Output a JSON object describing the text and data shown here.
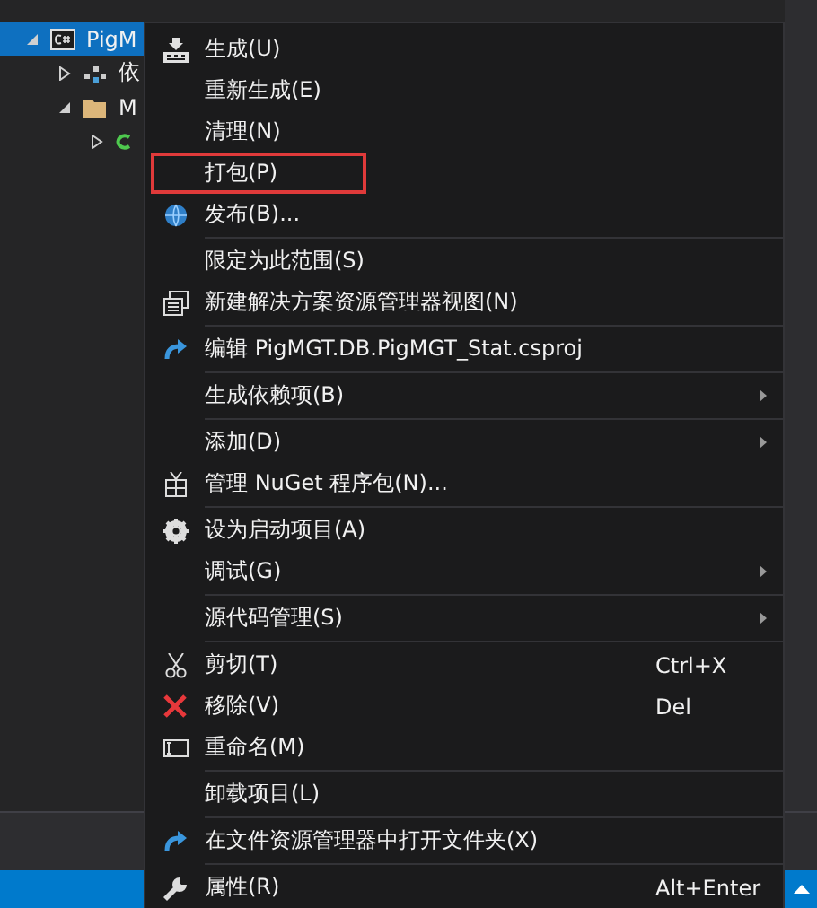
{
  "tree": [
    {
      "label": "PigM",
      "kind": "csharp",
      "expanded": true,
      "selected": true,
      "children": [
        {
          "label": "依",
          "kind": "deps",
          "expanded": false,
          "selected": false
        },
        {
          "label": "M",
          "kind": "folder",
          "expanded": true,
          "selected": false,
          "children": [
            {
              "kind": "class",
              "expanded": false,
              "selected": false
            }
          ]
        }
      ]
    }
  ],
  "menu": {
    "groups": [
      [
        {
          "label": "生成(U)",
          "kind": "build",
          "annotated": false
        },
        {
          "label": "重新生成(E)",
          "annotated": false
        },
        {
          "label": "清理(N)",
          "annotated": false
        },
        {
          "label": "打包(P)",
          "annotated": true
        },
        {
          "label": "发布(B)...",
          "kind": "globe",
          "annotated": false
        }
      ],
      [
        {
          "label": "限定为此范围(S)",
          "annotated": false
        },
        {
          "label": "新建解决方案资源管理器视图(N)",
          "kind": "newview",
          "annotated": false
        }
      ],
      [
        {
          "label": "编辑 PigMGT.DB.PigMGT_Stat.csproj",
          "kind": "redo",
          "annotated": false
        }
      ],
      [
        {
          "label": "生成依赖项(B)",
          "submenu": true,
          "annotated": false
        }
      ],
      [
        {
          "label": "添加(D)",
          "submenu": true,
          "annotated": false
        },
        {
          "label": "管理 NuGet 程序包(N)...",
          "kind": "package",
          "annotated": false
        }
      ],
      [
        {
          "label": "设为启动项目(A)",
          "kind": "gear",
          "annotated": false
        },
        {
          "label": "调试(G)",
          "submenu": true,
          "annotated": false
        }
      ],
      [
        {
          "label": "源代码管理(S)",
          "submenu": true,
          "annotated": false
        }
      ],
      [
        {
          "label": "剪切(T)",
          "kind": "cut",
          "shortcut": "Ctrl+X",
          "annotated": false
        },
        {
          "label": "移除(V)",
          "kind": "remove",
          "shortcut": "Del",
          "annotated": false
        },
        {
          "label": "重命名(M)",
          "kind": "rename",
          "annotated": false
        }
      ],
      [
        {
          "label": "卸载项目(L)",
          "annotated": false
        }
      ],
      [
        {
          "label": "在文件资源管理器中打开文件夹(X)",
          "kind": "redo",
          "annotated": false
        }
      ],
      [
        {
          "label": "属性(R)",
          "kind": "wrench",
          "shortcut": "Alt+Enter",
          "annotated": false
        }
      ]
    ]
  }
}
